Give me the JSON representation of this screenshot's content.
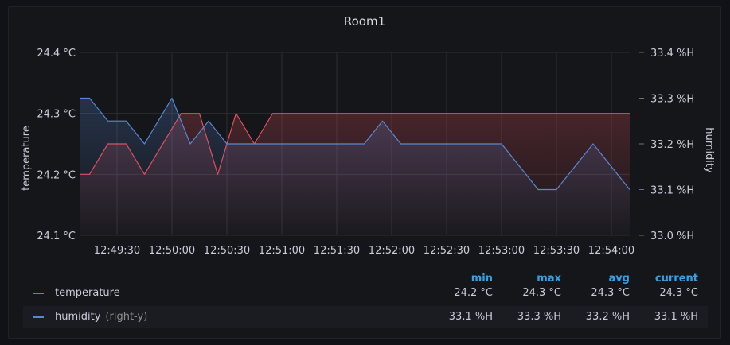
{
  "panel": {
    "title": "Room1"
  },
  "chart_data": {
    "type": "line",
    "x": [
      "12:49:10",
      "12:49:20",
      "12:49:30",
      "12:49:40",
      "12:49:50",
      "12:50:00",
      "12:50:10",
      "12:50:20",
      "12:50:30",
      "12:50:40",
      "12:50:50",
      "12:51:00",
      "12:51:10",
      "12:51:20",
      "12:51:30",
      "12:51:40",
      "12:51:50",
      "12:52:00",
      "12:52:10",
      "12:52:20",
      "12:52:30",
      "12:52:40",
      "12:52:50",
      "12:53:00",
      "12:53:10",
      "12:53:20",
      "12:53:30",
      "12:53:40",
      "12:53:50",
      "12:54:00",
      "12:54:10"
    ],
    "xticks": [
      "12:49:30",
      "12:50:00",
      "12:50:30",
      "12:51:00",
      "12:51:30",
      "12:52:00",
      "12:52:30",
      "12:53:00",
      "12:53:30",
      "12:54:00"
    ],
    "series": [
      {
        "name": "temperature",
        "axis": "left",
        "color": "#e0505e",
        "points": [
          [
            "12:49:10",
            24.2
          ],
          [
            "12:49:15",
            24.2
          ],
          [
            "12:49:25",
            24.25
          ],
          [
            "12:49:35",
            24.25
          ],
          [
            "12:49:45",
            24.2
          ],
          [
            "12:50:05",
            24.3
          ],
          [
            "12:50:15",
            24.3
          ],
          [
            "12:50:25",
            24.2
          ],
          [
            "12:50:35",
            24.3
          ],
          [
            "12:50:45",
            24.25
          ],
          [
            "12:50:55",
            24.3
          ],
          [
            "12:54:10",
            24.3
          ]
        ]
      },
      {
        "name": "humidity",
        "axis": "right",
        "color": "#5a86d6",
        "points": [
          [
            "12:49:10",
            33.3
          ],
          [
            "12:49:15",
            33.3
          ],
          [
            "12:49:25",
            33.25
          ],
          [
            "12:49:35",
            33.25
          ],
          [
            "12:49:45",
            33.2
          ],
          [
            "12:50:00",
            33.3
          ],
          [
            "12:50:10",
            33.2
          ],
          [
            "12:50:20",
            33.25
          ],
          [
            "12:50:30",
            33.2
          ],
          [
            "12:51:45",
            33.2
          ],
          [
            "12:51:55",
            33.25
          ],
          [
            "12:52:05",
            33.2
          ],
          [
            "12:53:00",
            33.2
          ],
          [
            "12:53:20",
            33.1
          ],
          [
            "12:53:30",
            33.1
          ],
          [
            "12:53:50",
            33.2
          ],
          [
            "12:54:10",
            33.1
          ]
        ]
      }
    ],
    "y_left": {
      "label": "temperature",
      "ticks": [
        24.1,
        24.2,
        24.3,
        24.4
      ],
      "tick_labels": [
        "24.1 °C",
        "24.2 °C",
        "24.3 °C",
        "24.4 °C"
      ],
      "range": [
        24.1,
        24.4
      ]
    },
    "y_right": {
      "label": "humidity",
      "ticks": [
        33.0,
        33.1,
        33.2,
        33.3,
        33.4
      ],
      "tick_labels": [
        "33.0 %H",
        "33.1 %H",
        "33.2 %H",
        "33.3 %H",
        "33.4 %H"
      ],
      "range": [
        33.0,
        33.4
      ]
    },
    "grid": true
  },
  "legend": {
    "headers": {
      "min": "min",
      "max": "max",
      "avg": "avg",
      "current": "current"
    },
    "rows": [
      {
        "name": "temperature",
        "extra": "",
        "color": "#e0505e",
        "min": "24.2 °C",
        "max": "24.3 °C",
        "avg": "24.3 °C",
        "current": "24.3 °C"
      },
      {
        "name": "humidity",
        "extra": "(right-y)",
        "color": "#5a86d6",
        "min": "33.1 %H",
        "max": "33.3 %H",
        "avg": "33.2 %H",
        "current": "33.1 %H"
      }
    ]
  }
}
